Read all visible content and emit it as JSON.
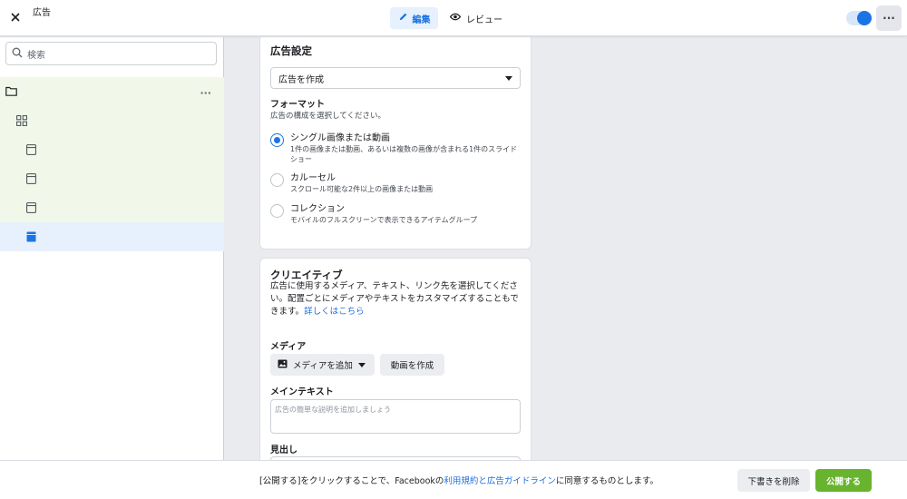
{
  "header": {
    "title": "広告",
    "tab_edit": "編集",
    "tab_review": "レビュー"
  },
  "sidebar": {
    "search_placeholder": "検索",
    "tree": [
      {
        "type": "campaign",
        "icon": "folder-icon"
      },
      {
        "type": "adset",
        "icon": "grid-icon"
      },
      {
        "type": "ad",
        "icon": "ad-icon"
      },
      {
        "type": "ad",
        "icon": "ad-icon"
      },
      {
        "type": "ad",
        "icon": "ad-icon"
      },
      {
        "type": "ad",
        "icon": "ad-icon",
        "selected": true
      }
    ]
  },
  "ad_settings": {
    "title": "広告設定",
    "select_value": "広告を作成",
    "format_label": "フォーマット",
    "format_sub": "広告の構成を選択してください。",
    "options": [
      {
        "title": "シングル画像または動画",
        "desc": "1件の画像または動画、あるいは複数の画像が含まれる1件のスライドショー",
        "selected": true
      },
      {
        "title": "カルーセル",
        "desc": "スクロール可能な2件以上の画像または動画",
        "selected": false
      },
      {
        "title": "コレクション",
        "desc": "モバイルのフルスクリーンで表示できるアイテムグループ",
        "selected": false
      }
    ]
  },
  "creative": {
    "title": "クリエイティブ",
    "desc": "広告に使用するメディア、テキスト、リンク先を選択してください。配置ごとにメディアやテキストをカスタマイズすることもできます。",
    "learn_more": "詳しくはこちら",
    "media_label": "メディア",
    "add_media": "メディアを追加",
    "create_video": "動画を作成",
    "primary_text_label": "メインテキスト",
    "primary_text_placeholder": "広告の簡単な説明を追加しましょう",
    "headline_label": "見出し"
  },
  "footer": {
    "terms_prefix": "[公開する]をクリックすることで、Facebookの",
    "terms_link": "利用規約と広告ガイドライン",
    "terms_suffix": "に同意するものとします。",
    "delete_draft": "下書きを削除",
    "publish": "公開する"
  },
  "colors": {
    "accent": "#1b74e4",
    "publish": "#69b42e",
    "campaign_bg": "#f1f8ea",
    "selected_bg": "#e7f0fd"
  }
}
